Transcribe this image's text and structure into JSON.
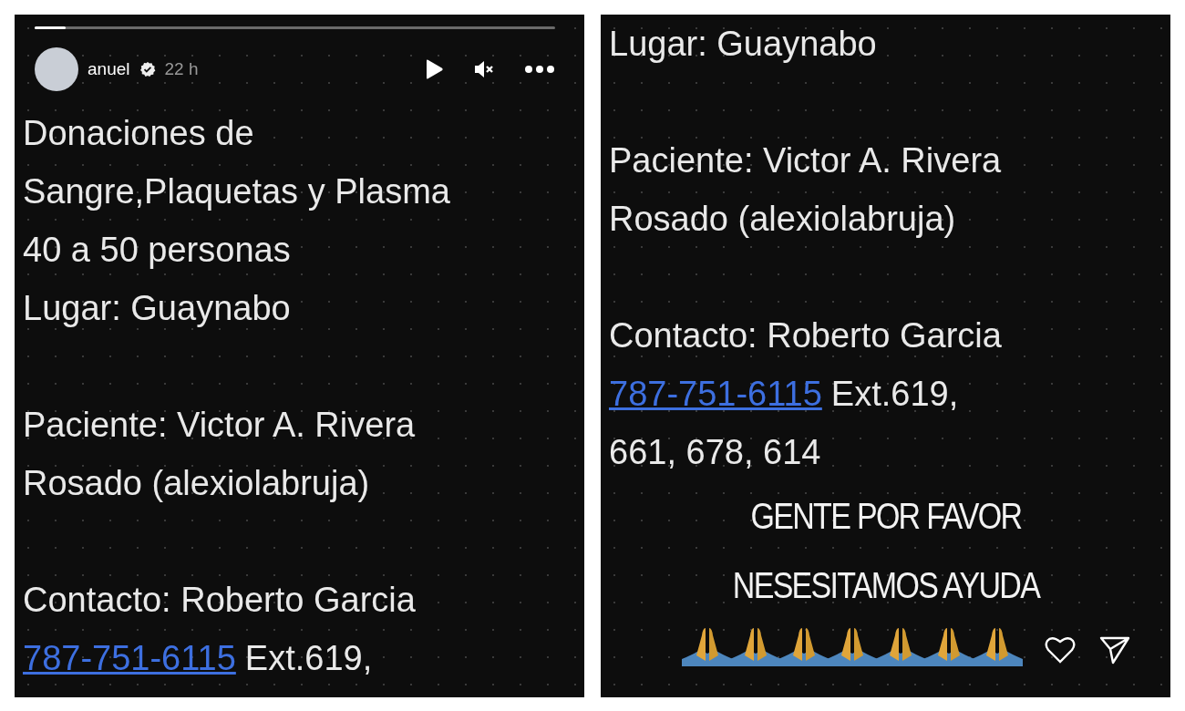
{
  "stories": [
    {
      "progress": {
        "level": 0.06
      },
      "header": {
        "username": "anuel",
        "time": "22 h"
      },
      "lines": [
        {
          "kind": "text",
          "text": "Donaciones de"
        },
        {
          "kind": "text",
          "text": "Sangre,Plaquetas y Plasma"
        },
        {
          "kind": "text",
          "text": "40 a 50 personas"
        },
        {
          "kind": "text",
          "text": "Lugar: Guaynabo"
        },
        {
          "kind": "gap"
        },
        {
          "kind": "text",
          "text": "Paciente: Victor A. Rivera"
        },
        {
          "kind": "text",
          "text": "Rosado (alexiolabruja)"
        },
        {
          "kind": "gap"
        },
        {
          "kind": "text",
          "text": "Contacto: Roberto Garcia"
        },
        {
          "kind": "phone",
          "link": "787-751-6115",
          "text": "Ext.619,"
        }
      ]
    },
    {
      "lines": [
        {
          "kind": "text",
          "text": "Lugar: Guaynabo"
        },
        {
          "kind": "gap"
        },
        {
          "kind": "text",
          "text": "Paciente: Victor A. Rivera"
        },
        {
          "kind": "text",
          "text": "Rosado (alexiolabruja)"
        },
        {
          "kind": "gap"
        },
        {
          "kind": "text",
          "text": "Contacto: Roberto Garcia"
        },
        {
          "kind": "phone",
          "link": "787-751-6115",
          "text": "Ext.619,"
        },
        {
          "kind": "text",
          "text": "661, 678, 614"
        },
        {
          "kind": "caption",
          "text": "GENTE POR FAVOR"
        },
        {
          "kind": "caption",
          "text": "NESESITAMOS AYUDA"
        },
        {
          "kind": "emoji"
        }
      ],
      "actions": true
    }
  ]
}
